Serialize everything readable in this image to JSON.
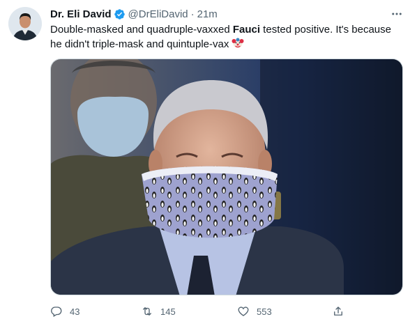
{
  "tweet": {
    "author": {
      "display_name": "Dr. Eli David",
      "handle": "@DrEliDavid",
      "verified": true,
      "verified_color": "#1d9bf0"
    },
    "separator": "·",
    "time": "21m",
    "text": {
      "before": "Double-masked and quadruple-vaxxed ",
      "bold": "Fauci",
      "after": " tested positive. It's because he didn't triple-mask and quintuple-vax",
      "emoji": "clown-face-emoji"
    },
    "media": {
      "icon": "photo",
      "description_icon": "tweet-photo"
    },
    "actions": {
      "replies": "43",
      "retweets": "145",
      "likes": "553"
    }
  },
  "colors": {
    "text_primary": "#0f1419",
    "text_secondary": "#536471",
    "accent": "#1d9bf0",
    "border": "#cfd9de"
  }
}
